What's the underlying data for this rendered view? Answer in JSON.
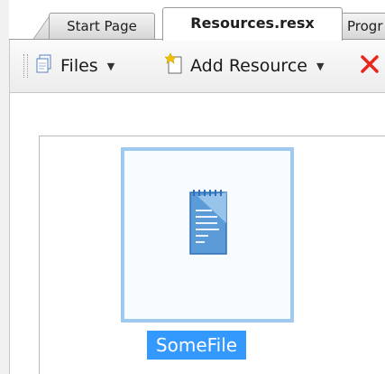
{
  "tabs": [
    {
      "label": "Start Page",
      "active": false
    },
    {
      "label": "Resources.resx",
      "active": true
    },
    {
      "label": "Progr",
      "active": false
    }
  ],
  "toolbar": {
    "files_label": "Files",
    "files_icon": "files-icon",
    "add_resource_label": "Add Resource",
    "add_resource_icon": "add-resource-icon",
    "delete_icon": "delete-icon",
    "dropdown_icon": "dropdown-arrow-icon"
  },
  "resources": {
    "items": [
      {
        "name": "SomeFile",
        "icon": "text-file-icon",
        "selected": true
      }
    ]
  },
  "colors": {
    "selection": "#3399ff",
    "tile_border": "#9ecaf0",
    "delete_red": "#e8261c"
  }
}
